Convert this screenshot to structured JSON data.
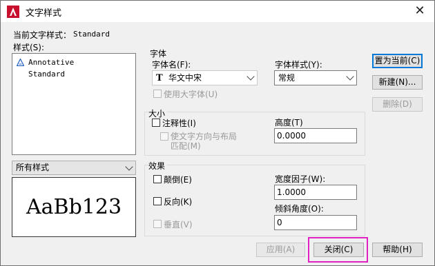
{
  "window": {
    "title": "文字样式",
    "close_glyph": "✕"
  },
  "current_style": {
    "label": "当前文字样式：",
    "value": "Standard"
  },
  "styles": {
    "label": "样式(S):",
    "items": [
      "Annotative",
      "Standard"
    ]
  },
  "filter": {
    "value": "所有样式"
  },
  "preview": {
    "text": "AaBb123"
  },
  "font": {
    "group_label": "字体",
    "font_name_label": "字体名(F):",
    "font_name_value": "华文中宋",
    "font_style_label": "字体样式(Y):",
    "font_style_value": "常规",
    "big_font_label": "使用大字体(U)"
  },
  "size": {
    "group_label": "大小",
    "annotative_label": "注释性(I)",
    "match_orientation_label_1": "使文字方向与布局",
    "match_orientation_label_2": "匹配(M)",
    "height_label": "高度(T)",
    "height_value": "0.0000"
  },
  "effects": {
    "group_label": "效果",
    "upside_down_label": "颠倒(E)",
    "backwards_label": "反向(K)",
    "vertical_label": "垂直(V)",
    "width_factor_label": "宽度因子(W):",
    "width_factor_value": "1.0000",
    "oblique_label": "倾斜角度(O):",
    "oblique_value": "0"
  },
  "buttons": {
    "set_current": "置为当前(C)",
    "new": "新建(N)...",
    "delete": "删除(D)",
    "apply": "应用(A)",
    "close": "关闭(C)",
    "help": "帮助(H)"
  },
  "colors": {
    "app_icon_red": "#c8102e",
    "highlight": "#e020c0",
    "selection_blue": "#0078d7"
  }
}
